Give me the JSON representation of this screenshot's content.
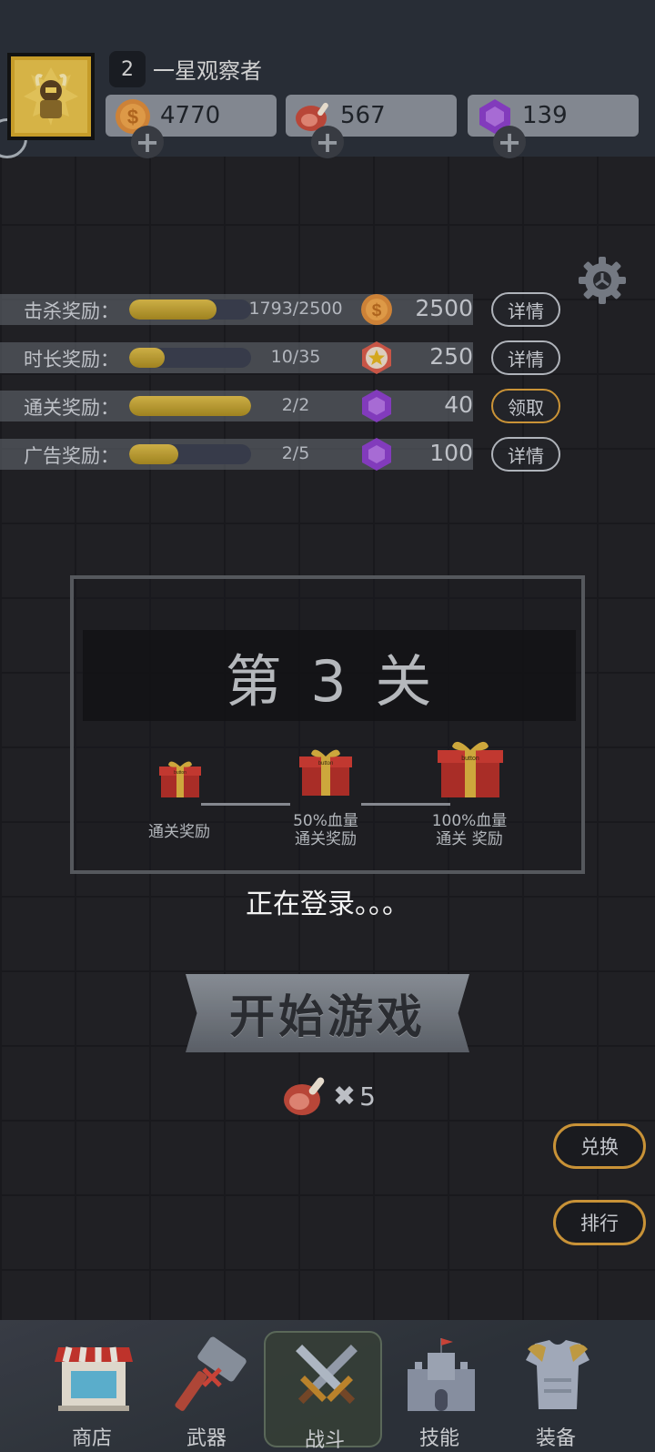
{
  "header": {
    "level": "2",
    "rank_title": "一星观察者",
    "resources": [
      {
        "icon": "coin-icon",
        "value": "4770"
      },
      {
        "icon": "meat-icon",
        "value": "567"
      },
      {
        "icon": "gem-icon",
        "value": "139"
      }
    ],
    "plus_glyph": "+"
  },
  "rewards": [
    {
      "label": "击杀奖励：",
      "progress": "1793/2500",
      "fill": 0.72,
      "icon": "coin-icon",
      "amount": "2500",
      "button": "详情",
      "claimable": false
    },
    {
      "label": "时长奖励：",
      "progress": "10/35",
      "fill": 0.29,
      "icon": "star-medal-icon",
      "amount": "250",
      "button": "详情",
      "claimable": false
    },
    {
      "label": "通关奖励：",
      "progress": "2/2",
      "fill": 1.0,
      "icon": "gem-icon",
      "amount": "40",
      "button": "领取",
      "claimable": true
    },
    {
      "label": "广告奖励：",
      "progress": "2/5",
      "fill": 0.4,
      "icon": "gem-icon",
      "amount": "100",
      "button": "详情",
      "claimable": false
    }
  ],
  "level_panel": {
    "title": "第 3 关",
    "gifts": [
      {
        "label": "通关奖励",
        "text": "button"
      },
      {
        "label": "50%血量\n通关奖励",
        "text": "button"
      },
      {
        "label": "100%血量\n通关 奖励",
        "text": "button"
      }
    ]
  },
  "status": "正在登录。。。",
  "start_button": "开始游戏",
  "cost": {
    "icon": "meat-icon",
    "multiply": "✖",
    "amount": "5"
  },
  "side_buttons": {
    "exchange": "兑换",
    "rank": "排行"
  },
  "nav": [
    {
      "label": "商店",
      "icon": "shop-icon",
      "active": false
    },
    {
      "label": "武器",
      "icon": "hammer-icon",
      "active": false
    },
    {
      "label": "战斗",
      "icon": "crossed-swords-icon",
      "active": true
    },
    {
      "label": "技能",
      "icon": "castle-icon",
      "active": false
    },
    {
      "label": "装备",
      "icon": "armor-icon",
      "active": false
    }
  ],
  "colors": {
    "gold_bar": "#c8a436",
    "claim_border": "#d59b3a",
    "gem": "#8a3fc7",
    "coin": "#d98a3a"
  }
}
